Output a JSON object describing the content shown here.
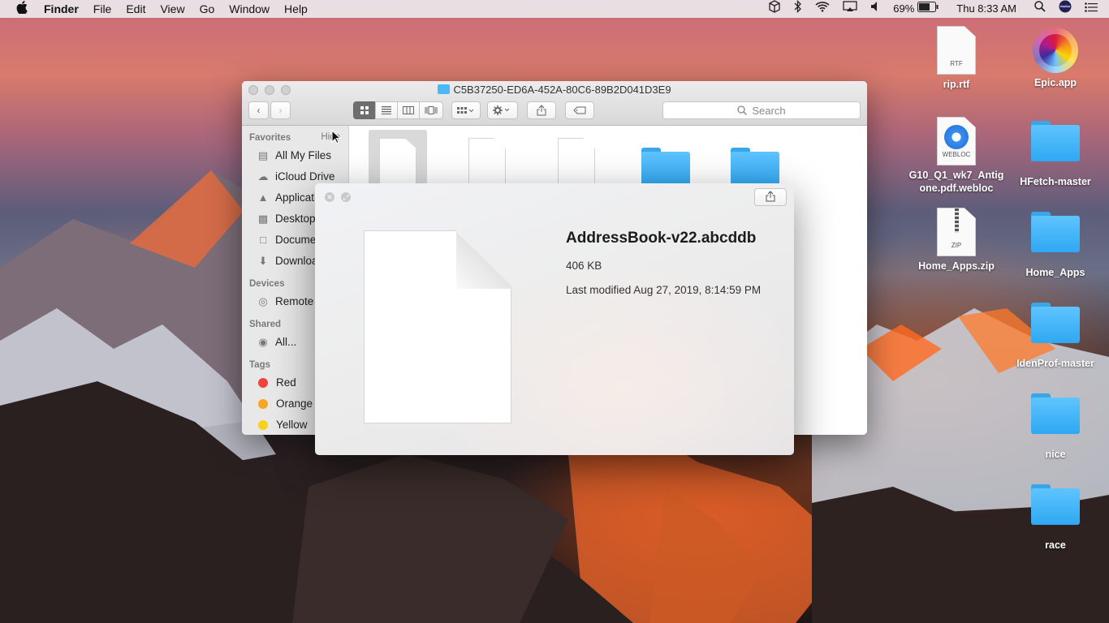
{
  "menubar": {
    "apple": "",
    "app": "Finder",
    "items": [
      "File",
      "Edit",
      "View",
      "Go",
      "Window",
      "Help"
    ],
    "status": {
      "battery": "69%",
      "clock": "Thu 8:33 AM"
    }
  },
  "desktop": {
    "icons": [
      {
        "label": "rip.rtf",
        "kind": "RTF"
      },
      {
        "label": "Epic.app",
        "kind": "app"
      },
      {
        "label": "G10_Q1_wk7_Antigone.pdf.webloc",
        "line1": "G10_Q1_wk7_Antig",
        "line2": "one.pdf.webloc",
        "kind": "WEBLOC"
      },
      {
        "label": "HFetch-master",
        "kind": "folder"
      },
      {
        "label": "Home_Apps.zip",
        "kind": "ZIP"
      },
      {
        "label": "Home_Apps",
        "kind": "folder"
      },
      {
        "label": "IdenProf-master",
        "kind": "folder"
      },
      {
        "label": "nice",
        "kind": "folder"
      },
      {
        "label": "race",
        "kind": "folder"
      }
    ]
  },
  "finder": {
    "title": "C5B37250-ED6A-452A-80C6-89B2D041D3E9",
    "search_placeholder": "Search",
    "sidebar": {
      "favorites_header": "Favorites",
      "hide": "Hide",
      "favorites": [
        {
          "label": "All My Files",
          "icon": "all-files-icon"
        },
        {
          "label": "iCloud Drive",
          "icon": "cloud-icon"
        },
        {
          "label": "Applications",
          "icon": "applications-icon"
        },
        {
          "label": "Desktop",
          "icon": "desktop-icon"
        },
        {
          "label": "Documents",
          "icon": "documents-icon"
        },
        {
          "label": "Downloads",
          "icon": "downloads-icon"
        }
      ],
      "devices_header": "Devices",
      "devices": [
        {
          "label": "Remote Disc",
          "icon": "disc-icon"
        }
      ],
      "shared_header": "Shared",
      "shared": [
        {
          "label": "All...",
          "icon": "network-icon"
        }
      ],
      "tags_header": "Tags",
      "tags": [
        {
          "label": "Red",
          "color": "#f0443a"
        },
        {
          "label": "Orange",
          "color": "#f5a623"
        },
        {
          "label": "Yellow",
          "color": "#f7d21b"
        }
      ]
    }
  },
  "quicklook": {
    "filename": "AddressBook-v22.abcddb",
    "size": "406 KB",
    "modified": "Last modified Aug 27, 2019, 8:14:59 PM"
  }
}
